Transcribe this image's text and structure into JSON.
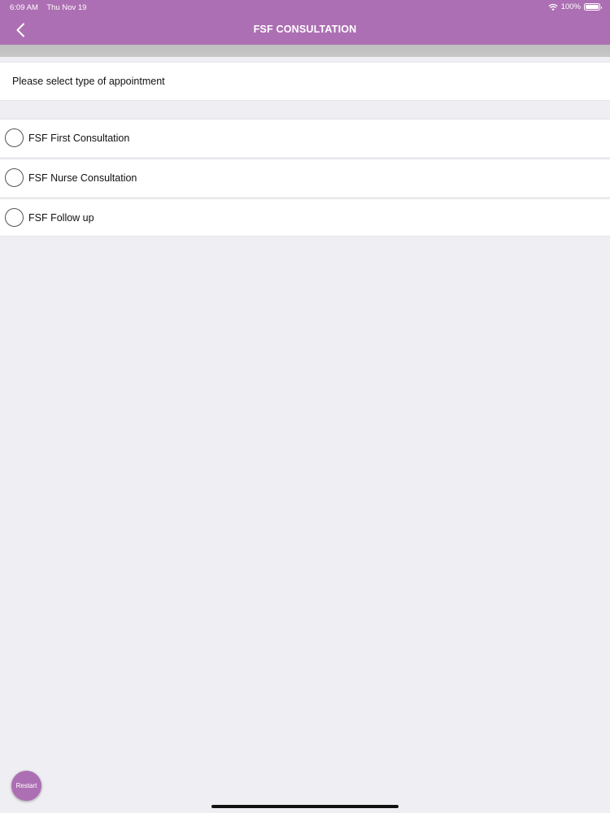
{
  "status_bar": {
    "time": "6:09 AM",
    "date": "Thu Nov 19",
    "battery": "100%",
    "wifi_icon": "wifi-icon",
    "battery_icon": "battery-icon"
  },
  "nav": {
    "title": "FSF CONSULTATION",
    "back_icon": "chevron-left-icon"
  },
  "prompt": "Please select type of appointment",
  "options": [
    {
      "label": "FSF First Consultation"
    },
    {
      "label": "FSF Nurse Consultation"
    },
    {
      "label": "FSF Follow up"
    }
  ],
  "restart_label": "Restart",
  "colors": {
    "accent": "#ad6fb3",
    "background": "#efeef3"
  }
}
